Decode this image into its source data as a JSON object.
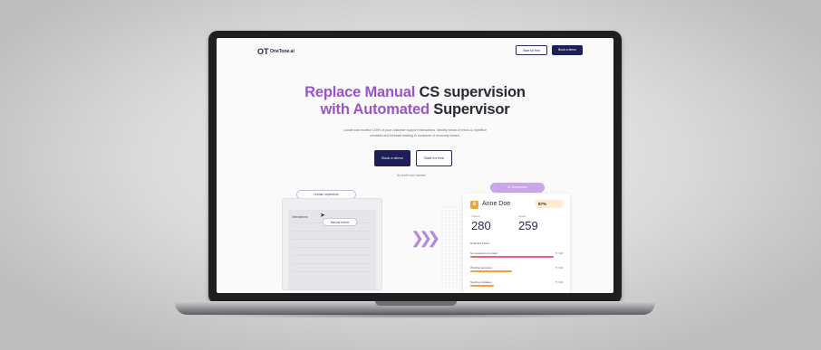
{
  "nav": {
    "logo_mark": "OT",
    "logo_text": "OneTone.ai",
    "secondary_button": "Start for free",
    "primary_button": "Book a demo"
  },
  "hero": {
    "line1_accent": "Replace Manual",
    "line1_rest": "CS supervision",
    "line2_accent": "with Automated",
    "line2_rest": "Supervisor",
    "subtitle_line1": "Locate and monitor 100% of your customer support interactions. Identify areas of errors & repetitive",
    "subtitle_line2": "mistakes and forecast leading to consumer & economy losses.",
    "cta_primary": "Book a demo",
    "cta_secondary": "Start for free",
    "note": "No credit card needed"
  },
  "left_mock": {
    "pill_top": "Human supervisor",
    "row_label": "Interactions",
    "pill_mid": "Manual review"
  },
  "right_card": {
    "tag": "AI Supervisor",
    "avatar_letter": "A",
    "agent_name": "Anne Doe",
    "score": "87%",
    "kpi1_label": "Tickets",
    "kpi1_value": "280",
    "kpi2_label": "Issues",
    "kpi2_value": "259",
    "section_note": "Detected issues",
    "metrics": [
      {
        "label": "No resolution provided",
        "value": "5 / 20",
        "color": "#e66a6a",
        "fill": 0.9
      },
      {
        "label": "Wording accuracy",
        "value": "5 / 10",
        "color": "#f3a23a",
        "fill": 0.45
      },
      {
        "label": "Spelling mistakes",
        "value": "5 / 10",
        "color": "#f3a23a",
        "fill": 0.25
      }
    ]
  }
}
